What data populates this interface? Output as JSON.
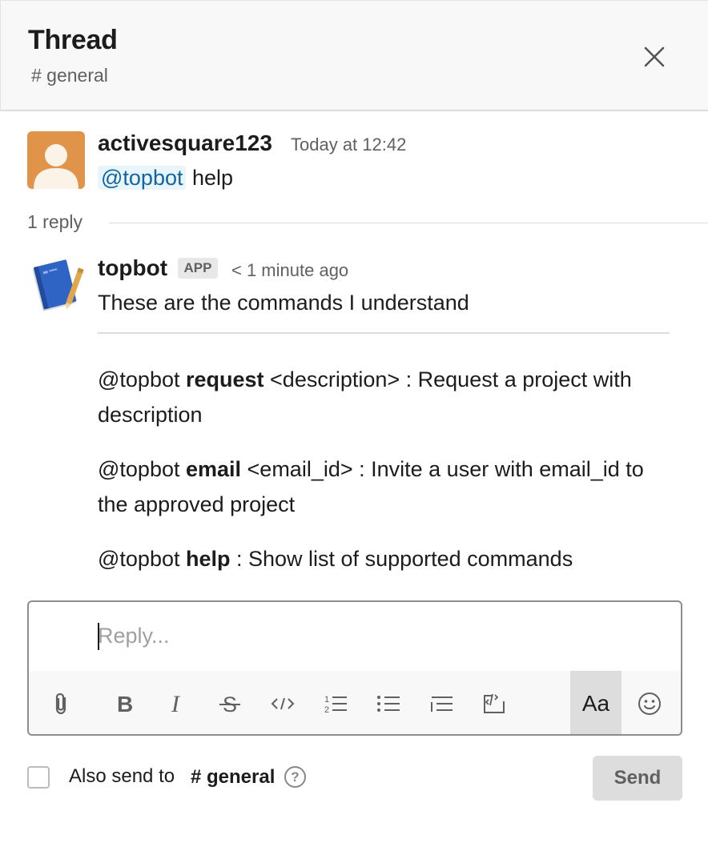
{
  "header": {
    "title": "Thread",
    "channel": "# general",
    "close_icon": "close-icon"
  },
  "parent_message": {
    "sender": "activesquare123",
    "timestamp": "Today at 12:42",
    "mention": "@topbot",
    "text": "help",
    "avatar_color": "#e0944a"
  },
  "replies": {
    "count_label": "1 reply"
  },
  "bot_message": {
    "sender": "topbot",
    "badge": "APP",
    "timestamp": "< 1 minute ago",
    "text": "These are the commands I understand",
    "commands": [
      {
        "prefix": "@topbot ",
        "command": "request",
        "suffix": " <description> : Request a project with description"
      },
      {
        "prefix": "@topbot ",
        "command": "email",
        "suffix": " <email_id> : Invite a user with email_id to the approved project"
      },
      {
        "prefix": "@topbot ",
        "command": "help",
        "suffix": " : Show list of supported commands"
      }
    ]
  },
  "composer": {
    "placeholder": "Reply...",
    "value": "",
    "toolbar": [
      {
        "name": "attach-icon"
      },
      {
        "name": "bold-icon"
      },
      {
        "name": "italic-icon"
      },
      {
        "name": "strikethrough-icon"
      },
      {
        "name": "code-icon"
      },
      {
        "name": "ordered-list-icon"
      },
      {
        "name": "bulleted-list-icon"
      },
      {
        "name": "blockquote-icon"
      },
      {
        "name": "code-block-icon"
      },
      {
        "name": "formatting-toggle-icon",
        "label": "Aa"
      },
      {
        "name": "emoji-icon"
      }
    ]
  },
  "footer": {
    "also_send_label": "Also send to",
    "also_send_channel": "# general",
    "also_send_checked": false,
    "help_icon": "?",
    "send_label": "Send"
  },
  "colors": {
    "mention_bg": "#e8f5fa",
    "mention_text": "#1264a3",
    "header_bg": "#f8f8f8",
    "send_disabled_bg": "#dddddd"
  }
}
